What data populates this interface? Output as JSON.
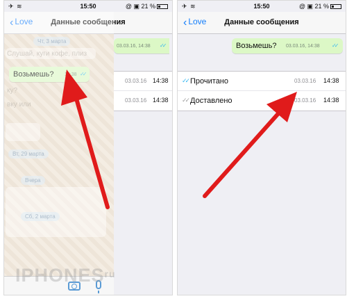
{
  "left_screen": {
    "status": {
      "carrier": "✈ ≋",
      "time": "15:50",
      "right": "@ ▣ 21 %"
    },
    "nav": {
      "back": "Love",
      "title": "Данные сообщения"
    },
    "sent_bubble": {
      "date": "03.03.16, 14:38"
    },
    "chat": {
      "date_chip": "Чт, 3 марта",
      "ghost_line1": "Слушай, куги кофе, плиз",
      "ghost_line2": "ку?",
      "ghost_line3": "вку или",
      "date_chip2": "Вт, 29 марта",
      "date_chip3": "Вчера",
      "date_chip4": "Сб, 2 марта",
      "bubble": {
        "text": "Возьмешь?",
        "time": "14:38"
      }
    },
    "rows": [
      {
        "date": "03.03.16",
        "time": "14:38"
      },
      {
        "date": "03.03.16",
        "time": "14:38"
      }
    ]
  },
  "right_screen": {
    "status": {
      "carrier": "✈ ≋",
      "time": "15:50",
      "right": "@ ▣ 21 %"
    },
    "nav": {
      "back": "Love",
      "title": "Данные сообщения"
    },
    "bubble": {
      "text": "Возьмешь?",
      "date": "03.03.16, 14:38"
    },
    "rows": [
      {
        "label": "Прочитано",
        "date": "03.03.16",
        "time": "14:38",
        "tick_color": "#34b7f1"
      },
      {
        "label": "Доставлено",
        "date": "03.03.16",
        "time": "14:38",
        "tick_color": "#a0a0a0"
      }
    ]
  },
  "watermark": {
    "text": "IPHONES",
    "suffix": "ru"
  },
  "colors": {
    "accent": "#147efb",
    "bubble": "#dcf8c6",
    "arrow": "#e01b1b"
  }
}
